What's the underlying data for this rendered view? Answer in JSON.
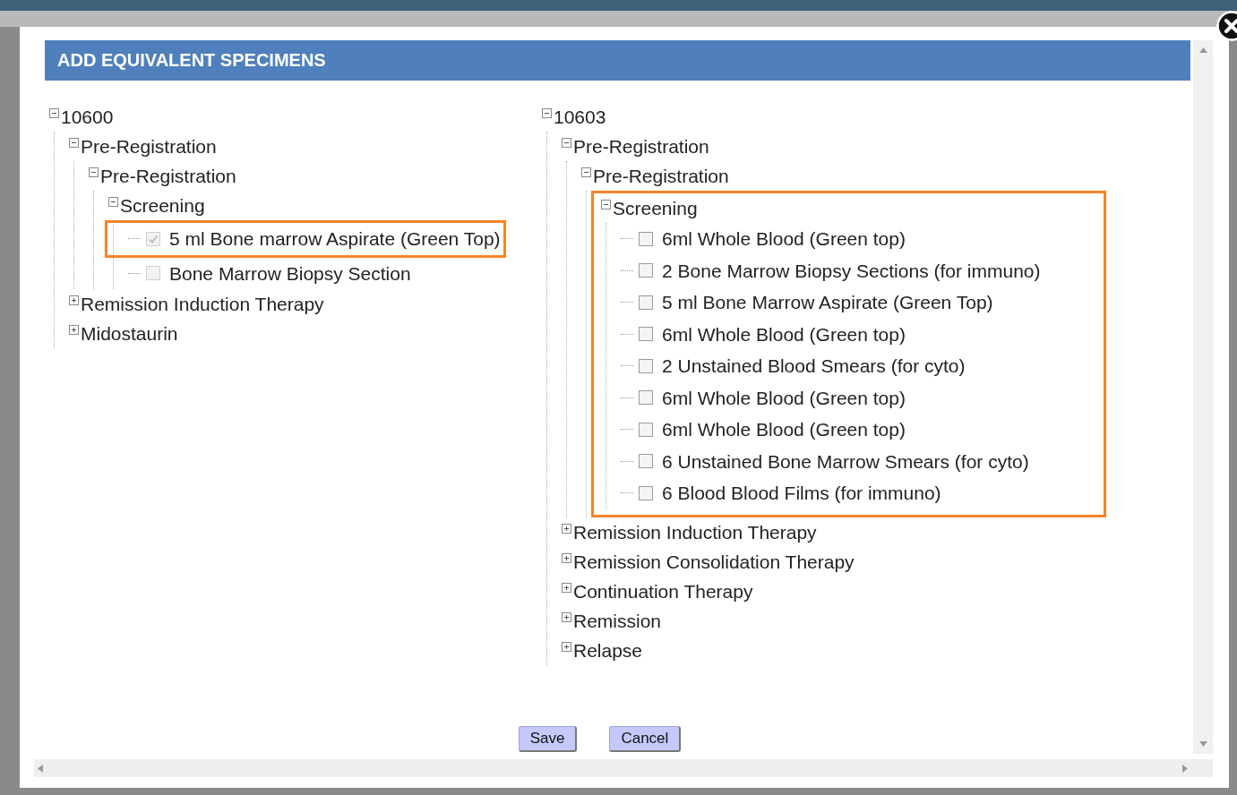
{
  "dialog": {
    "title": "ADD EQUIVALENT SPECIMENS"
  },
  "trees": [
    {
      "label": "10600",
      "expanded": true,
      "highlighted": false,
      "children": [
        {
          "label": "Pre-Registration",
          "expanded": true,
          "highlighted": false,
          "children": [
            {
              "label": "Pre-Registration",
              "expanded": true,
              "highlighted": false,
              "children": [
                {
                  "label": "Screening",
                  "expanded": true,
                  "highlighted": false,
                  "children": [
                    {
                      "kind": "checkbox",
                      "label": "5 ml Bone marrow Aspirate (Green Top)",
                      "checked": true,
                      "disabled": true,
                      "highlighted": true
                    },
                    {
                      "kind": "checkbox",
                      "label": "Bone Marrow Biopsy Section",
                      "checked": false,
                      "disabled": true,
                      "highlighted": false
                    }
                  ]
                }
              ]
            }
          ]
        },
        {
          "label": "Remission Induction Therapy",
          "expanded": false,
          "highlighted": false
        },
        {
          "label": "Midostaurin",
          "expanded": false,
          "highlighted": false
        }
      ]
    },
    {
      "label": "10603",
      "expanded": true,
      "highlighted": false,
      "children": [
        {
          "label": "Pre-Registration",
          "expanded": true,
          "highlighted": false,
          "children": [
            {
              "label": "Pre-Registration",
              "expanded": true,
              "highlighted": false,
              "children": [
                {
                  "label": "Screening",
                  "expanded": true,
                  "highlighted": true,
                  "children": [
                    {
                      "kind": "checkbox",
                      "label": "6ml Whole Blood (Green top)",
                      "checked": false,
                      "disabled": false,
                      "highlighted": false
                    },
                    {
                      "kind": "checkbox",
                      "label": "2 Bone Marrow Biopsy Sections (for immuno)",
                      "checked": false,
                      "disabled": false,
                      "highlighted": false
                    },
                    {
                      "kind": "checkbox",
                      "label": "5 ml Bone Marrow Aspirate (Green Top)",
                      "checked": false,
                      "disabled": false,
                      "highlighted": false
                    },
                    {
                      "kind": "checkbox",
                      "label": "6ml Whole Blood (Green top)",
                      "checked": false,
                      "disabled": false,
                      "highlighted": false
                    },
                    {
                      "kind": "checkbox",
                      "label": "2 Unstained Blood Smears (for cyto)",
                      "checked": false,
                      "disabled": false,
                      "highlighted": false
                    },
                    {
                      "kind": "checkbox",
                      "label": "6ml Whole Blood (Green top)",
                      "checked": false,
                      "disabled": false,
                      "highlighted": false
                    },
                    {
                      "kind": "checkbox",
                      "label": "6ml Whole Blood (Green top)",
                      "checked": false,
                      "disabled": false,
                      "highlighted": false
                    },
                    {
                      "kind": "checkbox",
                      "label": "6 Unstained Bone Marrow Smears (for cyto)",
                      "checked": false,
                      "disabled": false,
                      "highlighted": false
                    },
                    {
                      "kind": "checkbox",
                      "label": "6 Blood Blood Films (for immuno)",
                      "checked": false,
                      "disabled": false,
                      "highlighted": false
                    }
                  ]
                }
              ]
            }
          ]
        },
        {
          "label": "Remission Induction Therapy",
          "expanded": false,
          "highlighted": false
        },
        {
          "label": "Remission Consolidation Therapy",
          "expanded": false,
          "highlighted": false
        },
        {
          "label": "Continuation Therapy",
          "expanded": false,
          "highlighted": false
        },
        {
          "label": "Remission",
          "expanded": false,
          "highlighted": false
        },
        {
          "label": "Relapse",
          "expanded": false,
          "highlighted": false
        }
      ]
    }
  ],
  "buttons": [
    "Save",
    "Cancel"
  ]
}
